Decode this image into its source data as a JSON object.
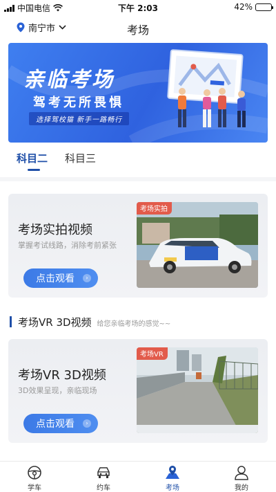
{
  "status_bar": {
    "carrier": "中国电信",
    "time": "下午 2:03",
    "battery": "42%",
    "battery_level": 0.42
  },
  "header": {
    "city": "南宁市",
    "title": "考场"
  },
  "banner": {
    "title": "亲临考场",
    "subtitle": "驾考无所畏惧",
    "slogan": "选择驾校猫 新手一路畅行"
  },
  "tabs": [
    {
      "label": "科目二",
      "active": true
    },
    {
      "label": "科目三",
      "active": false
    }
  ],
  "cards": [
    {
      "title": "考场实拍视频",
      "description": "掌握考试线路，消除考前紧张",
      "button": "点击观看",
      "tag": "考场实拍"
    },
    {
      "title": "考场VR 3D视频",
      "description": "3D效果呈现，亲临现场",
      "button": "点击观看",
      "tag": "考场VR"
    }
  ],
  "section": {
    "title": "考场VR 3D视频",
    "subtitle": "给您亲临考场的感觉~~"
  },
  "bottom_nav": [
    {
      "label": "学车",
      "icon": "steering-wheel-icon",
      "active": false
    },
    {
      "label": "约车",
      "icon": "car-icon",
      "active": false
    },
    {
      "label": "考场",
      "icon": "map-pin-icon",
      "active": true
    },
    {
      "label": "我的",
      "icon": "user-icon",
      "active": false
    }
  ],
  "colors": {
    "accent": "#1f4fa8",
    "button": "#3c7ae6",
    "tag": "#e25b4b",
    "banner": "#2f62df"
  }
}
